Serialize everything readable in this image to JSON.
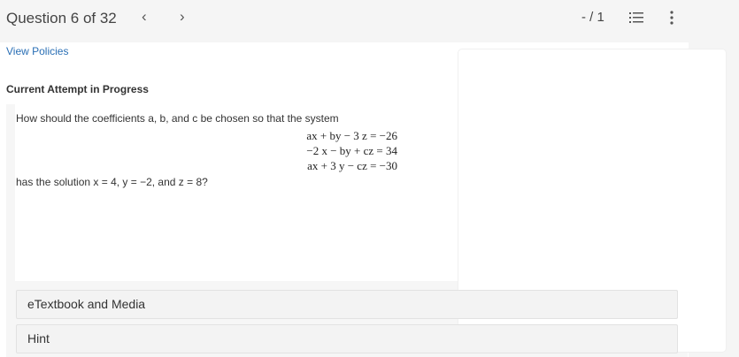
{
  "header": {
    "question_label": "Question 6 of 32",
    "prev_icon": "chevron-left-icon",
    "next_icon": "chevron-right-icon",
    "score": "- / 1",
    "list_icon": "numbered-list-icon",
    "more_icon": "more-vertical-icon"
  },
  "links": {
    "view_policies": "View Policies"
  },
  "attempt_label": "Current Attempt in Progress",
  "question": {
    "stem": "How should the coefficients a, b, and c be chosen so that the system",
    "equations": [
      "ax + by − 3 z = −26",
      "−2 x − by + cz = 34",
      "ax + 3 y − cz = −30"
    ],
    "solution": "has the solution x = 4, y = −2, and z = 8?"
  },
  "accordions": [
    {
      "label": "eTextbook and Media"
    },
    {
      "label": "Hint"
    }
  ],
  "colors": {
    "link": "#2a6fb5",
    "topbar_bg": "#f5f5f5",
    "panel_bg": "#f6f6f6"
  }
}
